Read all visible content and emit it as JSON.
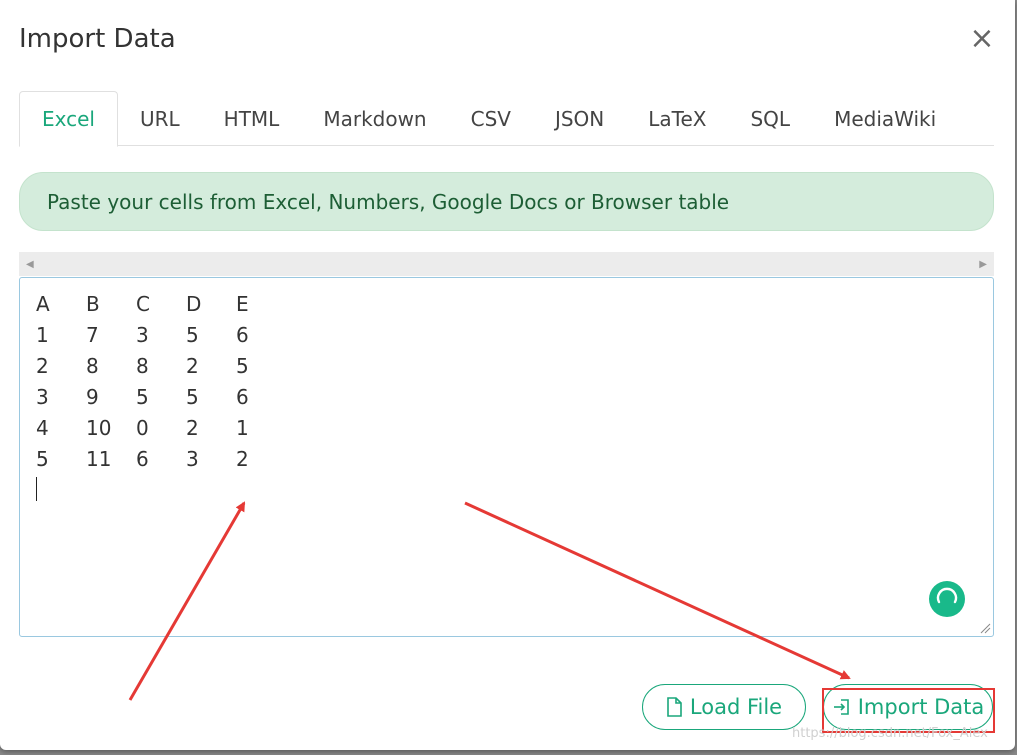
{
  "dialog": {
    "title": "Import Data",
    "close_label": "×"
  },
  "tabs": [
    {
      "label": "Excel",
      "active": true
    },
    {
      "label": "URL"
    },
    {
      "label": "HTML"
    },
    {
      "label": "Markdown"
    },
    {
      "label": "CSV"
    },
    {
      "label": "JSON"
    },
    {
      "label": "LaTeX"
    },
    {
      "label": "SQL"
    },
    {
      "label": "MediaWiki"
    }
  ],
  "hint": "Paste your cells from Excel, Numbers, Google Docs or Browser table",
  "scroll": {
    "left_arrow": "◀",
    "right_arrow": "▶"
  },
  "editor": {
    "rows": [
      [
        "A",
        "B",
        "C",
        "D",
        "E"
      ],
      [
        "1",
        "7",
        "3",
        "5",
        "6"
      ],
      [
        "2",
        "8",
        "8",
        "2",
        "5"
      ],
      [
        "3",
        "9",
        "5",
        "5",
        "6"
      ],
      [
        "4",
        "10",
        "0",
        "2",
        "1"
      ],
      [
        "5",
        "11",
        "6",
        "3",
        "2"
      ]
    ]
  },
  "buttons": {
    "load_file": "Load File",
    "import_data": "Import Data"
  },
  "watermark": "https://blog.csdn.net/Fox_Alex",
  "colors": {
    "accent": "#1aa77b",
    "hint_bg": "#d4ecdc",
    "annotation": "#e53935"
  },
  "icons": {
    "close": "close-icon",
    "load": "file-icon",
    "import": "import-icon",
    "spinner": "loading-icon"
  }
}
